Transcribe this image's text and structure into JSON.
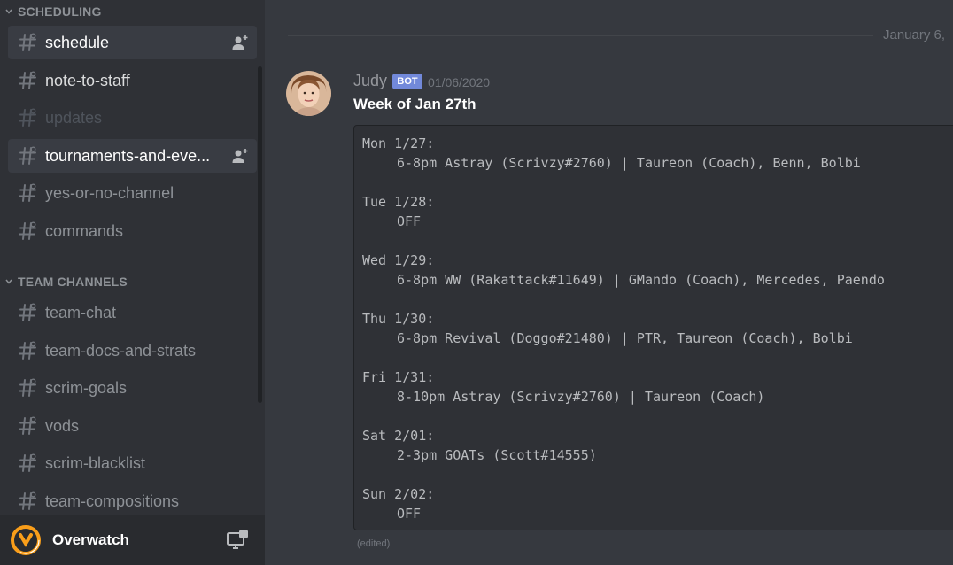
{
  "sidebar": {
    "categories": [
      {
        "label": "SCHEDULING"
      },
      {
        "label": "TEAM CHANNELS"
      }
    ],
    "scheduling_channels": [
      {
        "name": "schedule"
      },
      {
        "name": "note-to-staff"
      },
      {
        "name": "updates"
      },
      {
        "name": "tournaments-and-eve..."
      },
      {
        "name": "yes-or-no-channel"
      },
      {
        "name": "commands"
      }
    ],
    "team_channels": [
      {
        "name": "team-chat"
      },
      {
        "name": "team-docs-and-strats"
      },
      {
        "name": "scrim-goals"
      },
      {
        "name": "vods"
      },
      {
        "name": "scrim-blacklist"
      },
      {
        "name": "team-compositions"
      }
    ]
  },
  "user_panel": {
    "name": "Overwatch"
  },
  "chat": {
    "date_divider": "January 6,",
    "message": {
      "author": "Judy",
      "bot_tag": "BOT",
      "timestamp": "01/06/2020",
      "title": "Week of Jan 27th",
      "schedule": [
        {
          "day": "Mon 1/27:",
          "detail": "6-8pm Astray (Scrivzy#2760) | Taureon (Coach), Benn, Bolbi"
        },
        {
          "day": "Tue 1/28:",
          "detail": "OFF"
        },
        {
          "day": "Wed 1/29:",
          "detail": "6-8pm WW (Rakattack#11649) | GMando (Coach), Mercedes, Paendo"
        },
        {
          "day": "Thu 1/30:",
          "detail": "6-8pm Revival (Doggo#21480) | PTR, Taureon (Coach), Bolbi"
        },
        {
          "day": "Fri 1/31:",
          "detail": "8-10pm Astray (Scrivzy#2760) | Taureon (Coach)"
        },
        {
          "day": "Sat 2/01:",
          "detail": "2-3pm GOATs (Scott#14555)"
        },
        {
          "day": "Sun 2/02:",
          "detail": "OFF"
        }
      ],
      "edited_label": "(edited)"
    }
  },
  "colors": {
    "sidebar_bg": "#2f3136",
    "chat_bg": "#36393f",
    "bot_tag": "#7289da",
    "selected_channel": "#393c43"
  }
}
